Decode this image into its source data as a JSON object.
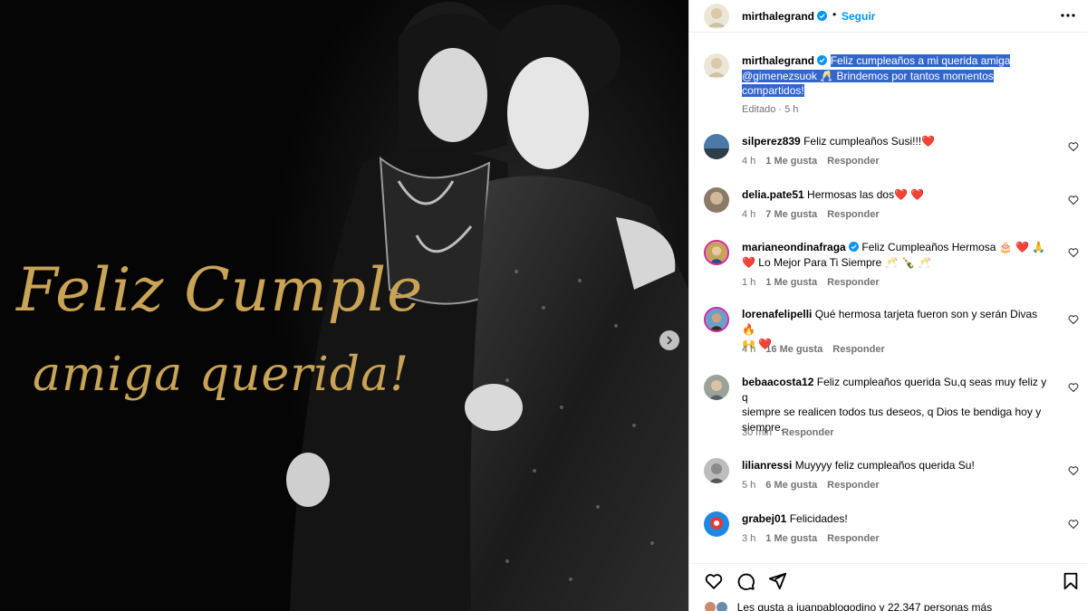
{
  "post": {
    "username": "mirthalegrand",
    "follow_label": "Seguir",
    "more_icon": "more-horizontal-icon"
  },
  "media": {
    "line1": "Feliz Cumple",
    "line2": "amiga querida!",
    "accent_color": "#c9a356",
    "next_icon": "chevron-right-icon"
  },
  "caption": {
    "username": "mirthalegrand",
    "text_line1": "Feliz cumpleaños a mi querida amiga",
    "text_line2": "@gimenezsuok 🥂 Brindemos por tantos momentos",
    "text_line3": "compartidos!",
    "edited": "Editado",
    "time": "5 h"
  },
  "comments": [
    {
      "user": "silperez839",
      "text": "Feliz cumpleaños Susi!!!❤️",
      "time": "4 h",
      "likes": "1 Me gusta",
      "reply": "Responder"
    },
    {
      "user": "delia.pate51",
      "text": "Hermosas las dos❤️ ❤️",
      "time": "4 h",
      "likes": "7 Me gusta",
      "reply": "Responder"
    },
    {
      "user": "marianeondinafraga",
      "text_line1": "Feliz Cumpleaños Hermosa 🎂 ❤️ 🙏",
      "text_line2": "❤️ Lo Mejor Para Ti Siempre 🥂 🍾 🥂",
      "time": "1 h",
      "likes": "1 Me gusta",
      "reply": "Responder"
    },
    {
      "user": "lorenafelipelli",
      "text_line1": "Qué hermosa tarjeta fueron son y serán Divas 🔥",
      "text_line2": "🙌 ❤️",
      "time": "4 h",
      "likes": "16 Me gusta",
      "reply": "Responder"
    },
    {
      "user": "bebaacosta12",
      "text_line1": "Feliz cumpleaños querida Su,q seas muy feliz y q",
      "text_line2": "siempre se realicen todos tus deseos, q Dios te bendiga hoy y",
      "text_line3": "siempre.",
      "time": "30 min",
      "reply": "Responder"
    },
    {
      "user": "lilianressi",
      "text": "Muyyyy feliz cumpleaños querida Su!",
      "time": "5 h",
      "likes": "6 Me gusta",
      "reply": "Responder"
    },
    {
      "user": "grabej01",
      "text": "Felicidades!",
      "time": "3 h",
      "likes": "1 Me gusta",
      "reply": "Responder"
    }
  ],
  "footer": {
    "likes_text": "Les gusta a juanpablogodino y 22.347 personas más"
  },
  "colors": {
    "link_blue": "#0095f6",
    "verified_blue": "#0095f6",
    "heart_red": "#ed4956",
    "highlight": "#3366cc"
  }
}
